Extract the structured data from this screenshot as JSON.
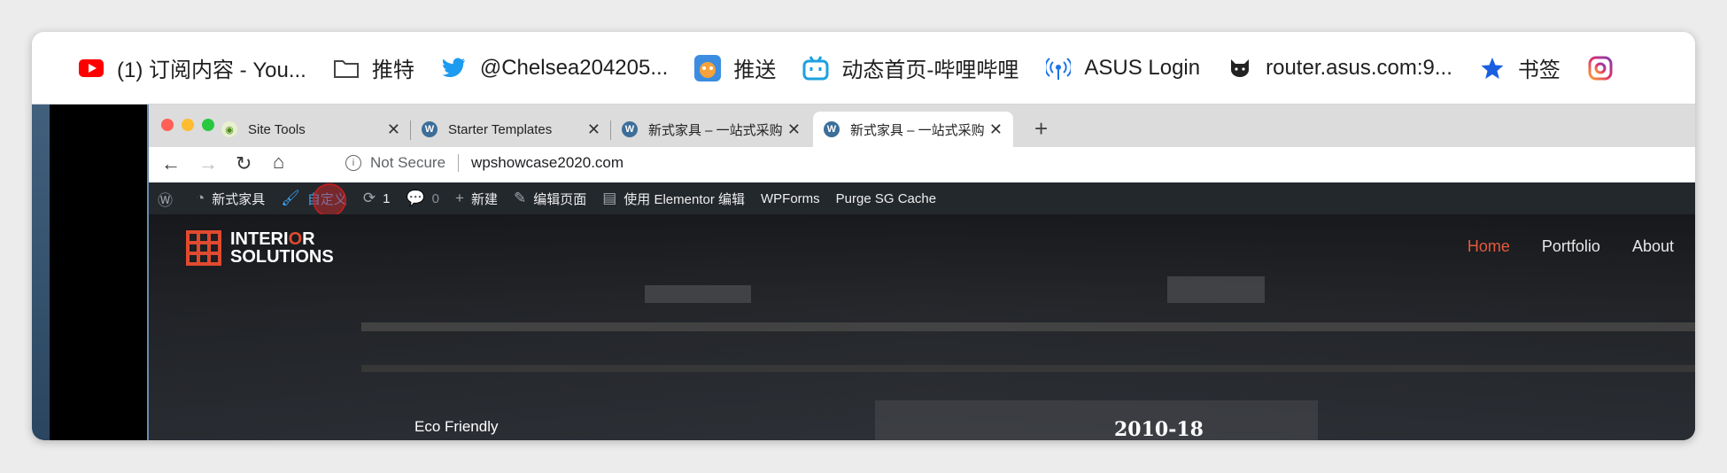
{
  "bookmarks": [
    {
      "label": "(1) 订阅内容 - You...",
      "icon": "youtube-icon"
    },
    {
      "label": "推特",
      "icon": "folder-icon"
    },
    {
      "label": "@Chelsea204205...",
      "icon": "twitter-icon"
    },
    {
      "label": "推送",
      "icon": "app-icon"
    },
    {
      "label": "动态首页-哔哩哔哩",
      "icon": "bilibili-icon"
    },
    {
      "label": "ASUS Login",
      "icon": "router-icon"
    },
    {
      "label": "router.asus.com:9...",
      "icon": "github-cat-icon"
    },
    {
      "label": "书签",
      "icon": "star-icon"
    }
  ],
  "tabs": [
    {
      "label": "Site Tools"
    },
    {
      "label": "Starter Templates"
    },
    {
      "label": "新式家具 – 一站式采购"
    },
    {
      "label": "新式家具 – 一站式采购"
    }
  ],
  "toolbar": {
    "security": "Not Secure",
    "url": "wpshowcase2020.com"
  },
  "adminbar": {
    "site": "新式家具",
    "customize": "自定义",
    "updates": "1",
    "comments": "0",
    "new": "新建",
    "edit": "编辑页面",
    "elementor": "使用 Elementor 编辑",
    "wpforms": "WPForms",
    "purge": "Purge SG Cache"
  },
  "site": {
    "logo_line1": "INTERI",
    "logo_o": "O",
    "logo_r": "R",
    "logo_line2": "SOLUTIONS",
    "nav": [
      "Home",
      "Portfolio",
      "About"
    ],
    "eco": "Eco Friendly",
    "year": "2010-18"
  },
  "colors": {
    "accent": "#e35a3c",
    "admin_bg": "#23282d",
    "highlight": "#3aa5f5"
  }
}
